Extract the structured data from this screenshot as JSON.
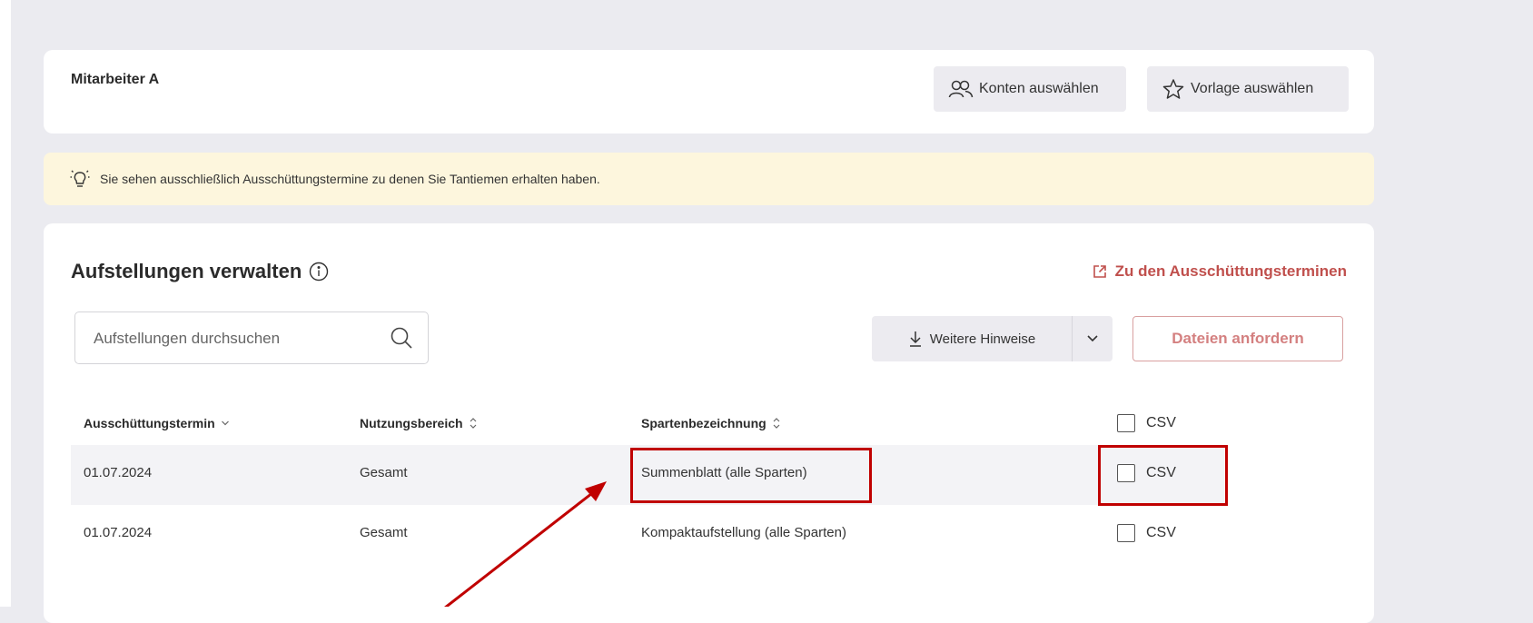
{
  "user": {
    "name": "Mitarbeiter A",
    "select_accounts_label": "Konten auswählen",
    "select_template_label": "Vorlage auswählen"
  },
  "info_banner": {
    "text": "Sie sehen ausschließlich Ausschüttungstermine zu denen Sie Tantiemen erhalten haben."
  },
  "section": {
    "title": "Aufstellungen verwalten",
    "external_link_label": "Zu den Ausschüttungsterminen",
    "search_placeholder": "Aufstellungen durchsuchen",
    "more_hints_label": "Weitere Hinweise",
    "request_files_label": "Dateien anfordern"
  },
  "table": {
    "columns": {
      "date": "Ausschüttungstermin",
      "area": "Nutzungsbereich",
      "category": "Spartenbezeichnung",
      "csv": "CSV"
    },
    "rows": [
      {
        "date": "01.07.2024",
        "area": "Gesamt",
        "category": "Summenblatt (alle Sparten)",
        "csv": "CSV"
      },
      {
        "date": "01.07.2024",
        "area": "Gesamt",
        "category": "Kompaktaufstellung (alle Sparten)",
        "csv": "CSV"
      }
    ]
  },
  "colors": {
    "accent": "#c0504d",
    "banner_background": "#fdf6dd",
    "annotation": "#c00000"
  }
}
